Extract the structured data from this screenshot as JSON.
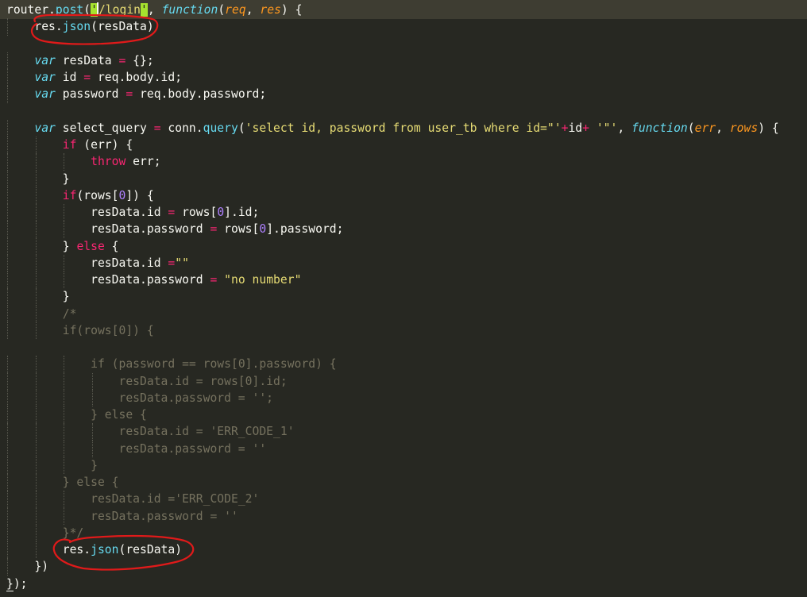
{
  "editor": {
    "theme": {
      "background": "#272822",
      "current_line": "#3E3D32",
      "foreground": "#F8F8F2",
      "keyword": "#F92672",
      "storage": "#66D9EF",
      "parameter": "#FD971F",
      "string": "#E6DB74",
      "number": "#AE81FF",
      "comment": "#75715E",
      "match_highlight": "#A6E22E",
      "annotation_ink": "#E01A1A"
    },
    "lines": [
      [
        [
          "pl",
          "router."
        ],
        [
          "fn",
          "post"
        ],
        [
          "pl",
          "("
        ],
        [
          "hl",
          "'"
        ],
        [
          "str",
          "/login"
        ],
        [
          "hl",
          "'"
        ],
        [
          "pl",
          ", "
        ],
        [
          "st",
          "function"
        ],
        [
          "pl",
          "("
        ],
        [
          "pr",
          "req"
        ],
        [
          "pl",
          ", "
        ],
        [
          "pr",
          "res"
        ],
        [
          "pl",
          ") {"
        ]
      ],
      [
        [
          "ws",
          "    "
        ],
        [
          "pl",
          "res."
        ],
        [
          "fn",
          "json"
        ],
        [
          "pl",
          "(resData)"
        ]
      ],
      [],
      [
        [
          "ws",
          "    "
        ],
        [
          "st",
          "var"
        ],
        [
          "pl",
          " resData "
        ],
        [
          "kw",
          "="
        ],
        [
          "pl",
          " {};"
        ]
      ],
      [
        [
          "ws",
          "    "
        ],
        [
          "st",
          "var"
        ],
        [
          "pl",
          " id "
        ],
        [
          "kw",
          "="
        ],
        [
          "pl",
          " req.body.id;"
        ]
      ],
      [
        [
          "ws",
          "    "
        ],
        [
          "st",
          "var"
        ],
        [
          "pl",
          " password "
        ],
        [
          "kw",
          "="
        ],
        [
          "pl",
          " req.body.password;"
        ]
      ],
      [],
      [
        [
          "ws",
          "    "
        ],
        [
          "st",
          "var"
        ],
        [
          "pl",
          " select_query "
        ],
        [
          "kw",
          "="
        ],
        [
          "pl",
          " conn."
        ],
        [
          "fn",
          "query"
        ],
        [
          "pl",
          "("
        ],
        [
          "str",
          "'select id, password from user_tb where id=\"'"
        ],
        [
          "kw",
          "+"
        ],
        [
          "pl",
          "id"
        ],
        [
          "kw",
          "+"
        ],
        [
          "pl",
          " "
        ],
        [
          "str",
          "'\"'"
        ],
        [
          "pl",
          ", "
        ],
        [
          "st",
          "function"
        ],
        [
          "pl",
          "("
        ],
        [
          "pr",
          "err"
        ],
        [
          "pl",
          ", "
        ],
        [
          "pr",
          "rows"
        ],
        [
          "pl",
          ") {"
        ]
      ],
      [
        [
          "ws",
          "        "
        ],
        [
          "kw",
          "if"
        ],
        [
          "pl",
          " (err) {"
        ]
      ],
      [
        [
          "ws",
          "            "
        ],
        [
          "kw",
          "throw"
        ],
        [
          "pl",
          " err;"
        ]
      ],
      [
        [
          "ws",
          "        "
        ],
        [
          "pl",
          "}"
        ]
      ],
      [
        [
          "ws",
          "        "
        ],
        [
          "kw",
          "if"
        ],
        [
          "pl",
          "(rows["
        ],
        [
          "num",
          "0"
        ],
        [
          "pl",
          "]) {"
        ]
      ],
      [
        [
          "ws",
          "            "
        ],
        [
          "pl",
          "resData.id "
        ],
        [
          "kw",
          "="
        ],
        [
          "pl",
          " rows["
        ],
        [
          "num",
          "0"
        ],
        [
          "pl",
          "].id;"
        ]
      ],
      [
        [
          "ws",
          "            "
        ],
        [
          "pl",
          "resData.password "
        ],
        [
          "kw",
          "="
        ],
        [
          "pl",
          " rows["
        ],
        [
          "num",
          "0"
        ],
        [
          "pl",
          "].password;"
        ]
      ],
      [
        [
          "ws",
          "        "
        ],
        [
          "pl",
          "} "
        ],
        [
          "kw",
          "else"
        ],
        [
          "pl",
          " {"
        ]
      ],
      [
        [
          "ws",
          "            "
        ],
        [
          "pl",
          "resData.id "
        ],
        [
          "kw",
          "="
        ],
        [
          "str",
          "\"\""
        ]
      ],
      [
        [
          "ws",
          "            "
        ],
        [
          "pl",
          "resData.password "
        ],
        [
          "kw",
          "="
        ],
        [
          "pl",
          " "
        ],
        [
          "str",
          "\"no number\""
        ]
      ],
      [
        [
          "ws",
          "        "
        ],
        [
          "pl",
          "}"
        ]
      ],
      [
        [
          "ws",
          "        "
        ],
        [
          "cm",
          "/*"
        ]
      ],
      [
        [
          "ws",
          "        "
        ],
        [
          "cm",
          "if(rows[0]) {"
        ]
      ],
      [],
      [
        [
          "ws",
          "            "
        ],
        [
          "cm",
          "if (password == rows[0].password) {"
        ]
      ],
      [
        [
          "ws",
          "                "
        ],
        [
          "cm",
          "resData.id = rows[0].id;"
        ]
      ],
      [
        [
          "ws",
          "                "
        ],
        [
          "cm",
          "resData.password = '';"
        ]
      ],
      [
        [
          "ws",
          "            "
        ],
        [
          "cm",
          "} else {"
        ]
      ],
      [
        [
          "ws",
          "                "
        ],
        [
          "cm",
          "resData.id = 'ERR_CODE_1'"
        ]
      ],
      [
        [
          "ws",
          "                "
        ],
        [
          "cm",
          "resData.password = ''"
        ]
      ],
      [
        [
          "ws",
          "            "
        ],
        [
          "cm",
          "}"
        ]
      ],
      [
        [
          "ws",
          "        "
        ],
        [
          "cm",
          "} else {"
        ]
      ],
      [
        [
          "ws",
          "            "
        ],
        [
          "cm",
          "resData.id ='ERR_CODE_2'"
        ]
      ],
      [
        [
          "ws",
          "            "
        ],
        [
          "cm",
          "resData.password = ''"
        ]
      ],
      [
        [
          "ws",
          "        "
        ],
        [
          "cm",
          "}*/"
        ]
      ],
      [
        [
          "ws",
          "        "
        ],
        [
          "pl",
          "res."
        ],
        [
          "fn",
          "json"
        ],
        [
          "pl",
          "(resData)"
        ]
      ],
      [
        [
          "ws",
          "    "
        ],
        [
          "pl",
          "})"
        ]
      ],
      [
        [
          "ul",
          "}"
        ],
        [
          "pl",
          ");"
        ]
      ]
    ]
  }
}
